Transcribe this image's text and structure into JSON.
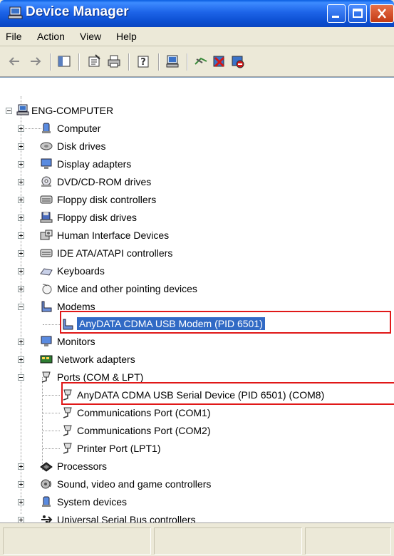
{
  "window": {
    "title": "Device Manager"
  },
  "menu": [
    "File",
    "Action",
    "View",
    "Help"
  ],
  "toolbar": [
    "back-icon",
    "forward-icon",
    "show-hide-tree-icon",
    "properties-icon",
    "print-icon",
    "help-icon",
    "scan-hardware-icon",
    "update-driver-icon",
    "uninstall-icon",
    "disable-icon"
  ],
  "tree": {
    "root": "ENG-COMPUTER",
    "items": [
      {
        "label": "Computer"
      },
      {
        "label": "Disk drives"
      },
      {
        "label": "Display adapters"
      },
      {
        "label": "DVD/CD-ROM drives"
      },
      {
        "label": "Floppy disk controllers"
      },
      {
        "label": "Floppy disk drives"
      },
      {
        "label": "Human Interface Devices"
      },
      {
        "label": "IDE ATA/ATAPI controllers"
      },
      {
        "label": "Keyboards"
      },
      {
        "label": "Mice and other pointing devices"
      },
      {
        "label": "Modems"
      },
      {
        "label": "AnyDATA CDMA USB Modem (PID 6501)"
      },
      {
        "label": "Monitors"
      },
      {
        "label": "Network adapters"
      },
      {
        "label": "Ports (COM & LPT)"
      },
      {
        "label": "AnyDATA CDMA USB Serial Device (PID 6501) (COM8)"
      },
      {
        "label": "Communications Port (COM1)"
      },
      {
        "label": "Communications Port (COM2)"
      },
      {
        "label": "Printer Port (LPT1)"
      },
      {
        "label": "Processors"
      },
      {
        "label": "Sound, video and game controllers"
      },
      {
        "label": "System devices"
      },
      {
        "label": "Universal Serial Bus controllers"
      }
    ]
  },
  "colors": {
    "highlight_box": "#e01818",
    "selection": "#316ac5",
    "titlebar": "#0b4ed1"
  }
}
